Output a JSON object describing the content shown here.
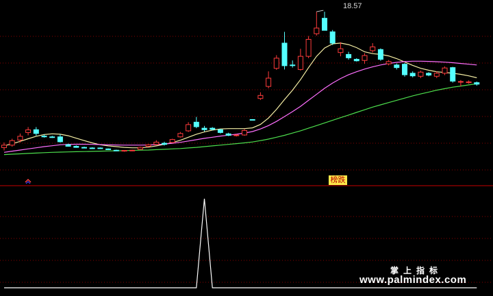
{
  "chart_data": {
    "type": "candlestick",
    "panels": [
      {
        "name": "price",
        "candles": [
          {
            "o": 11.35,
            "h": 11.62,
            "l": 11.2,
            "c": 11.48,
            "up": true
          },
          {
            "o": 11.48,
            "h": 11.82,
            "l": 11.4,
            "c": 11.72,
            "up": true
          },
          {
            "o": 11.75,
            "h": 12.1,
            "l": 11.62,
            "c": 11.95,
            "up": true
          },
          {
            "o": 12.15,
            "h": 12.44,
            "l": 12.0,
            "c": 12.29,
            "up": true
          },
          {
            "o": 12.3,
            "h": 12.44,
            "l": 11.98,
            "c": 12.1,
            "up": false
          },
          {
            "o": 11.96,
            "h": 12.05,
            "l": 11.88,
            "c": 11.92,
            "up": false
          },
          {
            "o": 11.92,
            "h": 11.98,
            "l": 11.86,
            "c": 11.9,
            "up": false
          },
          {
            "o": 11.92,
            "h": 12.06,
            "l": 11.62,
            "c": 11.66,
            "up": false
          },
          {
            "o": 11.5,
            "h": 11.56,
            "l": 11.4,
            "c": 11.42,
            "up": false
          },
          {
            "o": 11.42,
            "h": 11.47,
            "l": 11.34,
            "c": 11.36,
            "up": false
          },
          {
            "o": 11.36,
            "h": 11.4,
            "l": 11.31,
            "c": 11.33,
            "up": false
          },
          {
            "o": 11.33,
            "h": 11.37,
            "l": 11.28,
            "c": 11.31,
            "up": false
          },
          {
            "o": 11.33,
            "h": 11.36,
            "l": 11.28,
            "c": 11.3,
            "up": false
          },
          {
            "o": 11.28,
            "h": 11.31,
            "l": 11.22,
            "c": 11.24,
            "up": false
          },
          {
            "o": 11.21,
            "h": 11.24,
            "l": 11.16,
            "c": 11.18,
            "up": false
          },
          {
            "o": 11.16,
            "h": 11.22,
            "l": 11.13,
            "c": 11.2,
            "up": true
          },
          {
            "o": 11.2,
            "h": 11.23,
            "l": 11.16,
            "c": 11.21,
            "up": true
          },
          {
            "o": 11.26,
            "h": 11.4,
            "l": 11.24,
            "c": 11.36,
            "up": true
          },
          {
            "o": 11.42,
            "h": 11.54,
            "l": 11.38,
            "c": 11.5,
            "up": true
          },
          {
            "o": 11.52,
            "h": 11.74,
            "l": 11.48,
            "c": 11.64,
            "up": true
          },
          {
            "o": 11.58,
            "h": 11.66,
            "l": 11.46,
            "c": 11.52,
            "up": false
          },
          {
            "o": 11.62,
            "h": 11.82,
            "l": 11.58,
            "c": 11.78,
            "up": true
          },
          {
            "o": 11.92,
            "h": 12.18,
            "l": 11.88,
            "c": 12.1,
            "up": true
          },
          {
            "o": 12.24,
            "h": 12.7,
            "l": 12.18,
            "c": 12.57,
            "up": true
          },
          {
            "o": 12.7,
            "h": 12.98,
            "l": 12.38,
            "c": 12.46,
            "up": false
          },
          {
            "o": 12.38,
            "h": 12.5,
            "l": 12.2,
            "c": 12.3,
            "up": false
          },
          {
            "o": 12.38,
            "h": 12.44,
            "l": 12.26,
            "c": 12.32,
            "up": false
          },
          {
            "o": 12.3,
            "h": 12.34,
            "l": 12.1,
            "c": 12.15,
            "up": false
          },
          {
            "o": 12.08,
            "h": 12.14,
            "l": 11.96,
            "c": 12.0,
            "up": false
          },
          {
            "o": 12.0,
            "h": 12.06,
            "l": 11.94,
            "c": 12.02,
            "up": true
          },
          {
            "o": 12.02,
            "h": 12.34,
            "l": 11.98,
            "c": 12.26,
            "up": true
          },
          {
            "o": 12.84,
            "h": 12.86,
            "l": 12.84,
            "c": 12.84,
            "up": false
          },
          {
            "o": 13.96,
            "h": 14.29,
            "l": 13.88,
            "c": 14.12,
            "up": true
          },
          {
            "o": 14.6,
            "h": 15.4,
            "l": 14.5,
            "c": 15.04,
            "up": true
          },
          {
            "o": 15.56,
            "h": 16.26,
            "l": 15.48,
            "c": 16.1,
            "up": true
          },
          {
            "o": 16.9,
            "h": 17.5,
            "l": 15.5,
            "c": 15.7,
            "up": false
          },
          {
            "o": 15.72,
            "h": 15.98,
            "l": 15.6,
            "c": 15.74,
            "up": false
          },
          {
            "o": 15.5,
            "h": 16.6,
            "l": 15.44,
            "c": 16.2,
            "up": true
          },
          {
            "o": 16.2,
            "h": 17.28,
            "l": 16.1,
            "c": 17.1,
            "up": true
          },
          {
            "o": 17.4,
            "h": 18.57,
            "l": 17.3,
            "c": 17.7,
            "up": true
          },
          {
            "o": 18.22,
            "h": 18.57,
            "l": 17.9,
            "c": 17.58,
            "up": false
          },
          {
            "o": 17.5,
            "h": 17.6,
            "l": 16.8,
            "c": 16.9,
            "up": false
          },
          {
            "o": 16.6,
            "h": 16.95,
            "l": 16.2,
            "c": 16.4,
            "up": true
          },
          {
            "o": 16.3,
            "h": 16.44,
            "l": 16.02,
            "c": 16.12,
            "up": false
          },
          {
            "o": 16.04,
            "h": 16.1,
            "l": 15.92,
            "c": 15.96,
            "up": false
          },
          {
            "o": 15.98,
            "h": 16.36,
            "l": 15.8,
            "c": 16.24,
            "up": true
          },
          {
            "o": 16.5,
            "h": 16.9,
            "l": 16.4,
            "c": 16.7,
            "up": true
          },
          {
            "o": 16.56,
            "h": 16.62,
            "l": 15.96,
            "c": 16.04,
            "up": false
          },
          {
            "o": 15.92,
            "h": 16.0,
            "l": 15.72,
            "c": 15.8,
            "up": true
          },
          {
            "o": 15.74,
            "h": 15.82,
            "l": 15.5,
            "c": 15.6,
            "up": false
          },
          {
            "o": 15.78,
            "h": 15.84,
            "l": 15.12,
            "c": 15.22,
            "up": false
          },
          {
            "o": 15.3,
            "h": 15.4,
            "l": 15.08,
            "c": 15.16,
            "up": false
          },
          {
            "o": 15.14,
            "h": 15.44,
            "l": 15.04,
            "c": 15.36,
            "up": true
          },
          {
            "o": 15.3,
            "h": 15.36,
            "l": 15.14,
            "c": 15.2,
            "up": false
          },
          {
            "o": 15.14,
            "h": 15.4,
            "l": 15.04,
            "c": 15.3,
            "up": true
          },
          {
            "o": 15.3,
            "h": 15.66,
            "l": 15.2,
            "c": 15.58,
            "up": true
          },
          {
            "o": 15.6,
            "h": 15.64,
            "l": 14.8,
            "c": 14.88,
            "up": false
          },
          {
            "o": 14.86,
            "h": 14.94,
            "l": 14.6,
            "c": 14.84,
            "up": true
          },
          {
            "o": 14.84,
            "h": 14.92,
            "l": 14.74,
            "c": 14.8,
            "up": true
          },
          {
            "o": 14.8,
            "h": 14.86,
            "l": 14.64,
            "c": 14.72,
            "up": false
          }
        ],
        "moving_averages": [
          {
            "color": "#f7f0a6",
            "values": [
              11.45,
              11.55,
              11.68,
              11.82,
              11.95,
              12.04,
              12.08,
              12.06,
              11.98,
              11.85,
              11.72,
              11.6,
              11.5,
              11.44,
              11.4,
              11.36,
              11.34,
              11.34,
              11.37,
              11.44,
              11.52,
              11.62,
              11.74,
              11.9,
              12.06,
              12.18,
              12.28,
              12.34,
              12.36,
              12.36,
              12.36,
              12.4,
              12.58,
              12.92,
              13.38,
              13.9,
              14.4,
              14.96,
              15.6,
              16.2,
              16.64,
              16.86,
              16.9,
              16.82,
              16.66,
              16.44,
              16.34,
              16.3,
              16.22,
              16.08,
              15.9,
              15.72,
              15.56,
              15.46,
              15.38,
              15.34,
              15.3,
              15.24,
              15.16,
              15.06
            ]
          },
          {
            "color": "#ff6fff",
            "values": [
              11.1,
              11.16,
              11.22,
              11.28,
              11.34,
              11.4,
              11.45,
              11.5,
              11.52,
              11.53,
              11.53,
              11.52,
              11.51,
              11.5,
              11.49,
              11.48,
              11.48,
              11.48,
              11.49,
              11.51,
              11.54,
              11.58,
              11.63,
              11.7,
              11.77,
              11.84,
              11.9,
              11.96,
              12.01,
              12.06,
              12.12,
              12.2,
              12.34,
              12.52,
              12.74,
              13.0,
              13.26,
              13.54,
              13.86,
              14.18,
              14.5,
              14.78,
              15.02,
              15.22,
              15.38,
              15.52,
              15.64,
              15.74,
              15.82,
              15.88,
              15.92,
              15.94,
              15.94,
              15.93,
              15.91,
              15.89,
              15.86,
              15.82,
              15.78,
              15.74
            ]
          },
          {
            "color": "#4ddf4d",
            "values": [
              10.98,
              11.0,
              11.02,
              11.04,
              11.06,
              11.08,
              11.1,
              11.11,
              11.12,
              11.13,
              11.14,
              11.15,
              11.16,
              11.17,
              11.18,
              11.19,
              11.2,
              11.21,
              11.22,
              11.24,
              11.26,
              11.28,
              11.3,
              11.33,
              11.36,
              11.4,
              11.44,
              11.48,
              11.52,
              11.56,
              11.6,
              11.65,
              11.72,
              11.8,
              11.9,
              12.0,
              12.12,
              12.24,
              12.38,
              12.52,
              12.66,
              12.8,
              12.94,
              13.08,
              13.22,
              13.36,
              13.5,
              13.62,
              13.74,
              13.86,
              13.98,
              14.1,
              14.2,
              14.3,
              14.4,
              14.48,
              14.56,
              14.62,
              14.68,
              14.74
            ]
          }
        ],
        "annotations": {
          "high_value": "18.57",
          "signal_text": "榜跌"
        }
      },
      {
        "name": "indicator",
        "values": [
          0,
          0,
          0,
          0,
          0,
          0,
          0,
          0,
          0,
          0,
          0,
          0,
          0,
          0,
          0,
          0,
          0,
          0,
          0,
          0,
          0,
          0,
          0,
          0,
          0,
          1,
          0,
          0,
          0,
          0,
          0,
          0,
          0,
          0,
          0,
          0,
          0,
          0,
          0,
          0,
          0,
          0,
          0,
          0,
          0,
          0,
          0,
          0,
          0,
          0,
          0,
          0,
          0,
          0,
          0,
          0,
          0,
          0,
          0,
          0
        ],
        "ylim": [
          0,
          1
        ]
      }
    ],
    "grid": true
  },
  "watermark": {
    "title": "掌上指标",
    "url": "www.palmindex.com"
  },
  "colors": {
    "up": "#ff3b3b",
    "down": "#54ffff",
    "grid": "#8b0000",
    "separator": "#c80000",
    "indicator": "#ffffff",
    "signal_bg": "#ffe94a",
    "signal_fg": "#b30000"
  }
}
